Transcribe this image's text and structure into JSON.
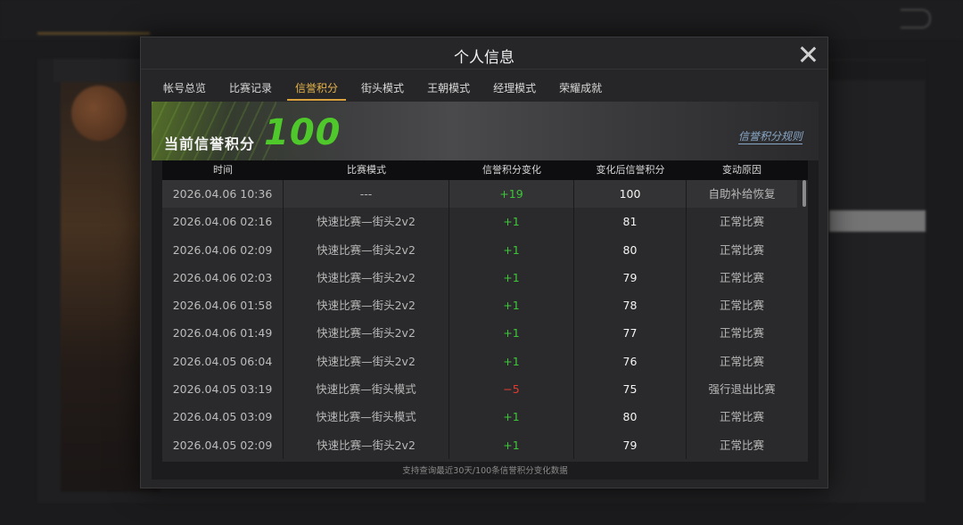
{
  "modal": {
    "title": "个人信息",
    "tabs": [
      {
        "label": "帐号总览"
      },
      {
        "label": "比赛记录"
      },
      {
        "label": "信誉积分"
      },
      {
        "label": "街头模式"
      },
      {
        "label": "王朝模式"
      },
      {
        "label": "经理模式"
      },
      {
        "label": "荣耀成就"
      }
    ],
    "active_tab_index": 2
  },
  "banner": {
    "label": "当前信誉积分",
    "score": "100",
    "rules_link": "信誉积分规则"
  },
  "table": {
    "headers": [
      "时间",
      "比赛模式",
      "信誉积分变化",
      "变化后信誉积分",
      "变动原因"
    ],
    "rows": [
      {
        "time": "2026.04.06  10:36",
        "mode": "---",
        "change": "+19",
        "after": "100",
        "reason": "自助补给恢复"
      },
      {
        "time": "2026.04.06  02:16",
        "mode": "快速比赛—街头2v2",
        "change": "+1",
        "after": "81",
        "reason": "正常比赛"
      },
      {
        "time": "2026.04.06  02:09",
        "mode": "快速比赛—街头2v2",
        "change": "+1",
        "after": "80",
        "reason": "正常比赛"
      },
      {
        "time": "2026.04.06  02:03",
        "mode": "快速比赛—街头2v2",
        "change": "+1",
        "after": "79",
        "reason": "正常比赛"
      },
      {
        "time": "2026.04.06  01:58",
        "mode": "快速比赛—街头2v2",
        "change": "+1",
        "after": "78",
        "reason": "正常比赛"
      },
      {
        "time": "2026.04.06  01:49",
        "mode": "快速比赛—街头2v2",
        "change": "+1",
        "after": "77",
        "reason": "正常比赛"
      },
      {
        "time": "2026.04.05  06:04",
        "mode": "快速比赛—街头2v2",
        "change": "+1",
        "after": "76",
        "reason": "正常比赛"
      },
      {
        "time": "2026.04.05  03:19",
        "mode": "快速比赛—街头模式",
        "change": "−5",
        "after": "75",
        "reason": "强行退出比赛"
      },
      {
        "time": "2026.04.05  03:09",
        "mode": "快速比赛—街头模式",
        "change": "+1",
        "after": "80",
        "reason": "正常比赛"
      },
      {
        "time": "2026.04.05  02:09",
        "mode": "快速比赛—街头2v2",
        "change": "+1",
        "after": "79",
        "reason": "正常比赛"
      }
    ],
    "footnote": "支持查询最近30天/100条信誉积分变化数据"
  },
  "colors": {
    "accent_gold": "#e6b34a",
    "score_green": "#4ec82a",
    "positive": "#3ec63a",
    "negative": "#e03c32"
  },
  "icons": {
    "close": "close-icon",
    "back": "back-arrow-icon"
  }
}
